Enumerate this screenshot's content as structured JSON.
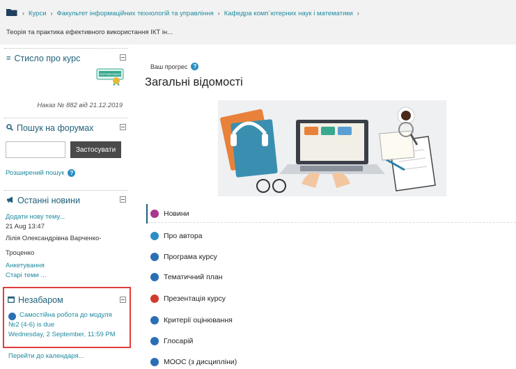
{
  "breadcrumb": {
    "items": [
      "Курси",
      "Факультет інформаційних технологій та управління",
      "Кафедра комп`ютерних наук і математики"
    ],
    "separator": "›"
  },
  "page_heading": "Теорія та практика ефективного використання ІКТ ін...",
  "sidebar": {
    "summary": {
      "title": "Стисло про курс",
      "badge_text": "СЕРТИФІКОВАНО",
      "order": "Наказ № 882 від 21.12.2019"
    },
    "search": {
      "title": "Пошук на форумах",
      "input_value": "",
      "apply_label": "Застосувати",
      "advanced_label": "Розширений пошук"
    },
    "news": {
      "title": "Останні новини",
      "add_topic": "Додати нову тему...",
      "date": "21 Aug 13:47",
      "author_line1": "Лілія Олександрівна Варченко-",
      "author_line2": "Троценко",
      "post_title": "Анкетування",
      "old_topics": "Старі теми ..."
    },
    "upcoming": {
      "title": "Незабаром",
      "event_line1": "Самостійна робота до модуля",
      "event_line2": "№2 (4-6) is due",
      "event_line3": "Wednesday, 2 September, 11:59 PM",
      "calendar_link": "Перейти до календаря..."
    }
  },
  "main": {
    "progress_label": "Ваш прогрес",
    "section_title": "Загальні відомості",
    "activities": [
      {
        "label": "Новини",
        "color": "#a8358f"
      },
      {
        "label": "Про автора",
        "color": "#2a8ec4"
      },
      {
        "label": "Програма курсу",
        "color": "#2a6fb5"
      },
      {
        "label": "Тематичний план",
        "color": "#2a6fb5"
      },
      {
        "label": "Презентація курсу",
        "color": "#d23a2a"
      },
      {
        "label": "Критерії оцінювання",
        "color": "#2a6fb5"
      },
      {
        "label": "Глосарій",
        "color": "#2a6fb5"
      },
      {
        "label": "МООС (з дисципліни)",
        "color": "#2a6fb5"
      }
    ]
  },
  "colors": {
    "link": "#1f8a9e",
    "block_title": "#1f5f7a",
    "highlight_border": "#e23b3b",
    "button": "#4a4a4a"
  }
}
